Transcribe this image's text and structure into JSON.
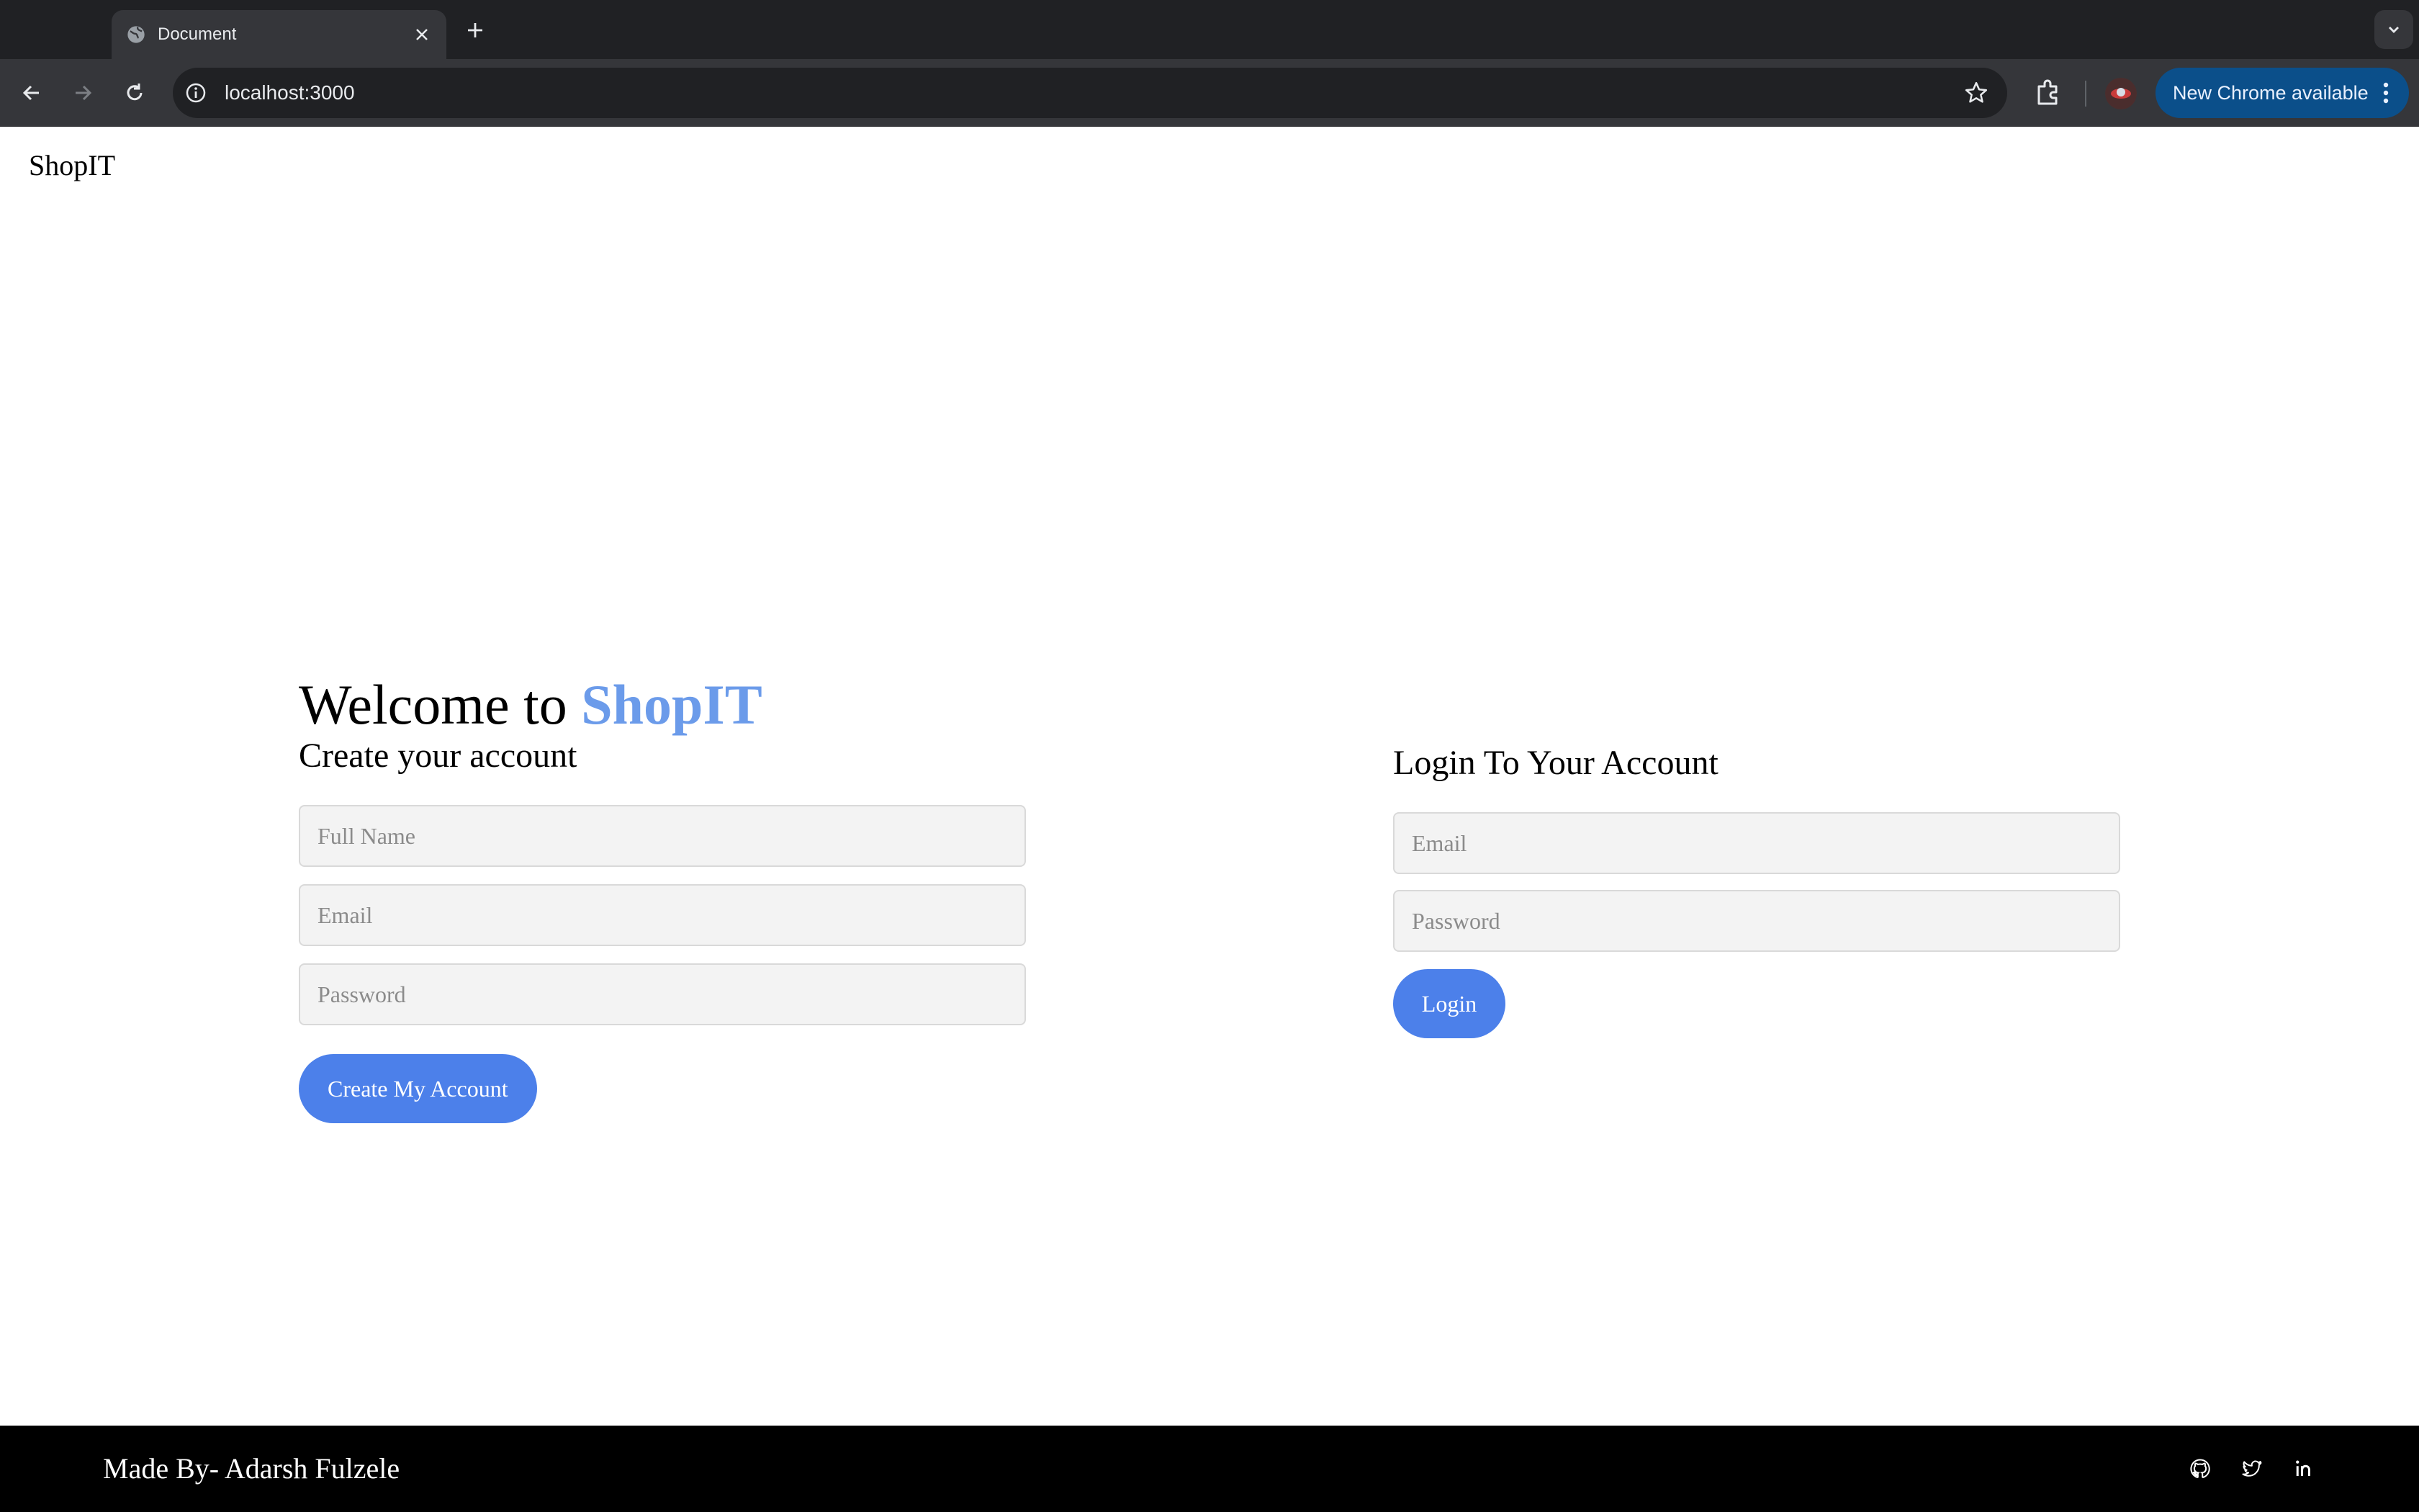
{
  "browser": {
    "tab_title": "Document",
    "url": "localhost:3000",
    "update_button": "New Chrome available"
  },
  "header": {
    "brand": "ShopIT"
  },
  "signup": {
    "welcome_prefix": "Welcome to ",
    "welcome_brand": "ShopIT",
    "subtitle": "Create your account",
    "fullname_placeholder": "Full Name",
    "email_placeholder": "Email",
    "password_placeholder": "Password",
    "submit_label": "Create My Account"
  },
  "login": {
    "title": "Login To Your Account",
    "email_placeholder": "Email",
    "password_placeholder": "Password",
    "submit_label": "Login"
  },
  "footer": {
    "credit": "Made By- Adarsh Fulzele",
    "social_icons": [
      "github-icon",
      "twitter-icon",
      "linkedin-icon"
    ]
  },
  "colors": {
    "accent": "#6b9bea",
    "button": "#4c80ea",
    "footer_bg": "#000000",
    "input_bg": "#f3f3f3"
  }
}
